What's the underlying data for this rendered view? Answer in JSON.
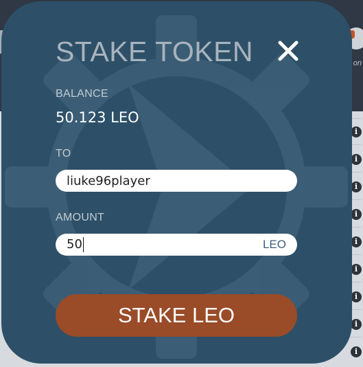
{
  "modal": {
    "title": "STAKE TOKEN",
    "close_label": "X",
    "balance": {
      "label": "BALANCE",
      "value": "50.123 LEO"
    },
    "to": {
      "label": "TO",
      "value": "liuke96player"
    },
    "amount": {
      "label": "AMOUNT",
      "value": "50",
      "suffix": "LEO"
    },
    "submit_label": "STAKE LEO"
  },
  "background": {
    "hint_text": "on",
    "info_icon_glyph": "i"
  },
  "colors": {
    "modal_bg": "#2d5068",
    "button_bg": "#9a4b28",
    "title": "#a8b3bd"
  },
  "icons": {
    "close": "close-icon",
    "watermark": "gear-logo-icon",
    "info": "info-icon"
  }
}
